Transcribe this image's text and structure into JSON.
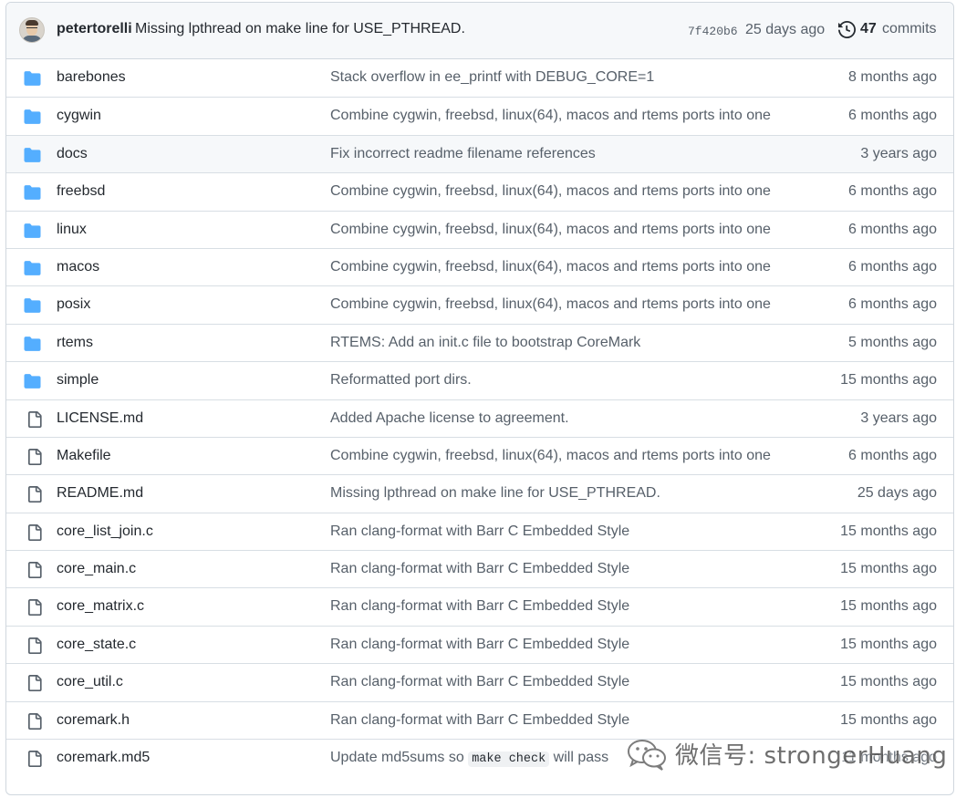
{
  "header": {
    "author": "petertorelli",
    "message": "Missing lpthread on make line for USE_PTHREAD.",
    "sha": "7f420b6",
    "time": "25 days ago",
    "commit_count": "47",
    "commit_label": "commits"
  },
  "files": [
    {
      "type": "folder",
      "name": "barebones",
      "message": "Stack overflow in ee_printf with DEBUG_CORE=1",
      "time": "8 months ago"
    },
    {
      "type": "folder",
      "name": "cygwin",
      "message": "Combine cygwin, freebsd, linux(64), macos and rtems ports into one",
      "time": "6 months ago"
    },
    {
      "type": "folder",
      "name": "docs",
      "message": "Fix incorrect readme filename references",
      "time": "3 years ago",
      "hover": true
    },
    {
      "type": "folder",
      "name": "freebsd",
      "message": "Combine cygwin, freebsd, linux(64), macos and rtems ports into one",
      "time": "6 months ago"
    },
    {
      "type": "folder",
      "name": "linux",
      "message": "Combine cygwin, freebsd, linux(64), macos and rtems ports into one",
      "time": "6 months ago"
    },
    {
      "type": "folder",
      "name": "macos",
      "message": "Combine cygwin, freebsd, linux(64), macos and rtems ports into one",
      "time": "6 months ago"
    },
    {
      "type": "folder",
      "name": "posix",
      "message": "Combine cygwin, freebsd, linux(64), macos and rtems ports into one",
      "time": "6 months ago"
    },
    {
      "type": "folder",
      "name": "rtems",
      "message": "RTEMS: Add an init.c file to bootstrap CoreMark",
      "time": "5 months ago"
    },
    {
      "type": "folder",
      "name": "simple",
      "message": "Reformatted port dirs.",
      "time": "15 months ago"
    },
    {
      "type": "file",
      "name": "LICENSE.md",
      "message": "Added Apache license to agreement.",
      "time": "3 years ago"
    },
    {
      "type": "file",
      "name": "Makefile",
      "message": "Combine cygwin, freebsd, linux(64), macos and rtems ports into one",
      "time": "6 months ago"
    },
    {
      "type": "file",
      "name": "README.md",
      "message": "Missing lpthread on make line for USE_PTHREAD.",
      "time": "25 days ago"
    },
    {
      "type": "file",
      "name": "core_list_join.c",
      "message": "Ran clang-format with Barr C Embedded Style",
      "time": "15 months ago"
    },
    {
      "type": "file",
      "name": "core_main.c",
      "message": "Ran clang-format with Barr C Embedded Style",
      "time": "15 months ago"
    },
    {
      "type": "file",
      "name": "core_matrix.c",
      "message": "Ran clang-format with Barr C Embedded Style",
      "time": "15 months ago"
    },
    {
      "type": "file",
      "name": "core_state.c",
      "message": "Ran clang-format with Barr C Embedded Style",
      "time": "15 months ago"
    },
    {
      "type": "file",
      "name": "core_util.c",
      "message": "Ran clang-format with Barr C Embedded Style",
      "time": "15 months ago"
    },
    {
      "type": "file",
      "name": "coremark.h",
      "message": "Ran clang-format with Barr C Embedded Style",
      "time": "15 months ago"
    },
    {
      "type": "file",
      "name": "coremark.md5",
      "message_pre": "Update md5sums so ",
      "message_code": "make check",
      "message_post": " will pass",
      "time": "11 months ago"
    }
  ],
  "watermark": {
    "text": "微信号: strongerHuang"
  },
  "colors": {
    "folder": "#54aeff",
    "file_icon": "#57606a",
    "border": "#d0d7de",
    "header_bg": "#f6f8fa"
  },
  "icons": {
    "folder": "folder-icon",
    "file": "file-icon",
    "history": "history-icon",
    "watermark": "wechat-icon"
  }
}
